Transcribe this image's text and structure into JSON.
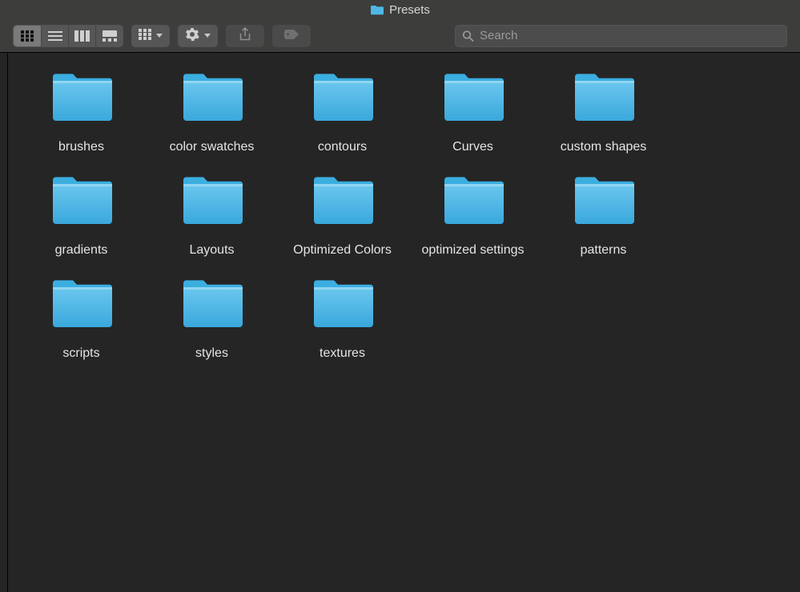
{
  "window": {
    "title": "Presets"
  },
  "toolbar": {
    "search_placeholder": "Search"
  },
  "folders": [
    {
      "name": "brushes"
    },
    {
      "name": "color swatches"
    },
    {
      "name": "contours"
    },
    {
      "name": "Curves"
    },
    {
      "name": "custom shapes"
    },
    {
      "name": "gradients"
    },
    {
      "name": "Layouts"
    },
    {
      "name": "Optimized Colors"
    },
    {
      "name": "optimized settings"
    },
    {
      "name": "patterns"
    },
    {
      "name": "scripts"
    },
    {
      "name": "styles"
    },
    {
      "name": "textures"
    }
  ],
  "colors": {
    "folder_fill": "#55b8e6",
    "folder_tab": "#3baee0"
  }
}
